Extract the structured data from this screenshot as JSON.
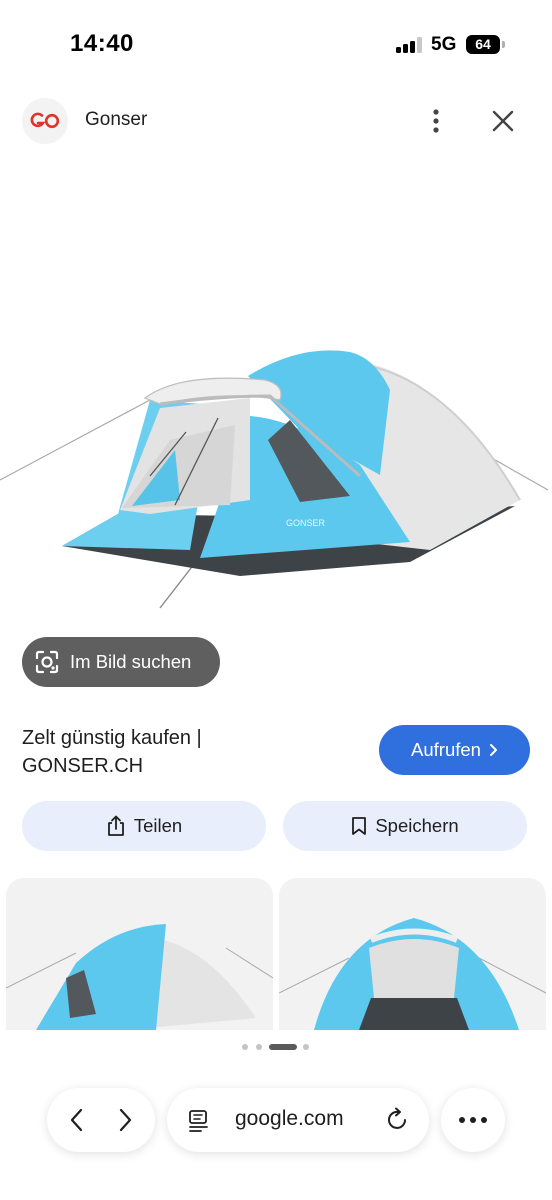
{
  "status_bar": {
    "time": "14:40",
    "network": "5G",
    "battery": "64"
  },
  "source": {
    "name": "Gonser",
    "logo_text": "GO"
  },
  "main_image": {
    "brand_print": "GONSER"
  },
  "lens": {
    "label": "Im Bild suchen"
  },
  "result": {
    "title_line1": "Zelt günstig kaufen |",
    "title_line2": "GONSER.CH",
    "visit_label": "Aufrufen"
  },
  "actions": {
    "share_label": "Teilen",
    "save_label": "Speichern"
  },
  "browser": {
    "url": "google.com"
  },
  "colors": {
    "accent": "#2f6fde",
    "logo_red": "#e0332b",
    "tent_blue": "#5cc8ee",
    "tent_grey": "#e6e6e6"
  },
  "icons": [
    "signal-icon",
    "battery-icon",
    "more-vert-icon",
    "close-icon",
    "lens-camera-icon",
    "chevron-right-icon",
    "share-icon",
    "bookmark-icon",
    "back-icon",
    "forward-icon",
    "reader-icon",
    "reload-icon",
    "more-horiz-icon"
  ]
}
